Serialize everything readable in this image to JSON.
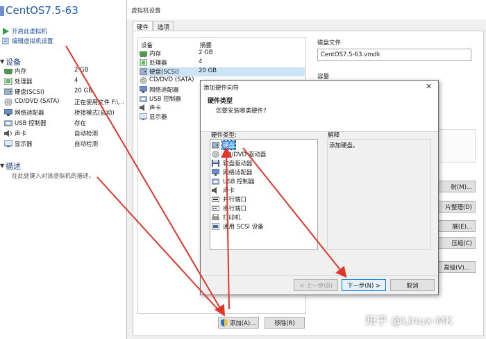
{
  "vm": {
    "title": "CentOS7.5-63",
    "actions": [
      "开启此虚拟机",
      "编辑虚拟机设置"
    ],
    "devices_heading": "设备",
    "devices": [
      {
        "name": "内存",
        "value": "2 GB",
        "icon": "memory-icon"
      },
      {
        "name": "处理器",
        "value": "4",
        "icon": "cpu-icon"
      },
      {
        "name": "硬盘(SCSI)",
        "value": "20 GB",
        "icon": "harddisk-icon"
      },
      {
        "name": "CD/DVD (SATA)",
        "value": "正在使用文件 F:\\...",
        "icon": "cdrom-icon"
      },
      {
        "name": "网络适配器",
        "value": "桥接模式(自动)",
        "icon": "network-icon"
      },
      {
        "name": "USB 控制器",
        "value": "存在",
        "icon": "usb-icon"
      },
      {
        "name": "声卡",
        "value": "自动检测",
        "icon": "sound-icon"
      },
      {
        "name": "显示器",
        "value": "自动检测",
        "icon": "display-icon"
      }
    ],
    "description_heading": "描述",
    "description_placeholder": "在此处键入对该虚拟机的描述。"
  },
  "settings": {
    "title": "虚拟机设置",
    "tabs": [
      "硬件",
      "选项"
    ],
    "columns": {
      "device": "设备",
      "summary": "摘要"
    },
    "hardware": [
      {
        "name": "内存",
        "value": "2 GB",
        "icon": "memory-icon"
      },
      {
        "name": "处理器",
        "value": "4",
        "icon": "cpu-icon"
      },
      {
        "name": "硬盘(SCSI)",
        "value": "20 GB",
        "icon": "harddisk-icon",
        "selected": true
      },
      {
        "name": "CD/DVD (SATA)",
        "value": "",
        "icon": "cdrom-icon"
      },
      {
        "name": "网络适配器",
        "value": "",
        "icon": "network-icon"
      },
      {
        "name": "USB 控制器",
        "value": "",
        "icon": "usb-icon"
      },
      {
        "name": "声卡",
        "value": "",
        "icon": "sound-icon"
      },
      {
        "name": "显示器",
        "value": "",
        "icon": "display-icon"
      }
    ],
    "disk_file_label": "磁盘文件",
    "disk_file_value": "CentOS7.5-63.vmdk",
    "capacity_label": "容量",
    "right_buttons": [
      "射(M)...",
      "片整理(D)",
      "展(E)...",
      "压缩(C)",
      "高级(V)..."
    ],
    "add_button": "添加(A)...",
    "remove_button": "移除(R)"
  },
  "wizard": {
    "title": "添加硬件向导",
    "heading": "硬件类型",
    "subheading": "您要安装哪类硬件?",
    "types_label": "硬件类型:",
    "types": [
      {
        "name": "硬盘",
        "icon": "harddisk-icon",
        "selected": true
      },
      {
        "name": "CD/DVD 驱动器",
        "icon": "cdrom-icon"
      },
      {
        "name": "软盘驱动器",
        "icon": "floppy-icon"
      },
      {
        "name": "网络适配器",
        "icon": "network-icon"
      },
      {
        "name": "USB 控制器",
        "icon": "usb-icon"
      },
      {
        "name": "声卡",
        "icon": "sound-icon"
      },
      {
        "name": "并行端口",
        "icon": "parallel-port-icon"
      },
      {
        "name": "串行端口",
        "icon": "serial-port-icon"
      },
      {
        "name": "打印机",
        "icon": "printer-icon"
      },
      {
        "name": "通用 SCSI 设备",
        "icon": "scsi-icon"
      }
    ],
    "explain_label": "解释",
    "explain_text": "添加硬盘。",
    "back_button": "< 上一步(B)",
    "next_button": "下一步(N) >",
    "cancel_button": "取消"
  },
  "watermark": "知乎 @Linux-MK",
  "colors": {
    "accent": "#1f5fa6",
    "selection": "#3399ff",
    "annotation_arrow": "#e0352b"
  }
}
